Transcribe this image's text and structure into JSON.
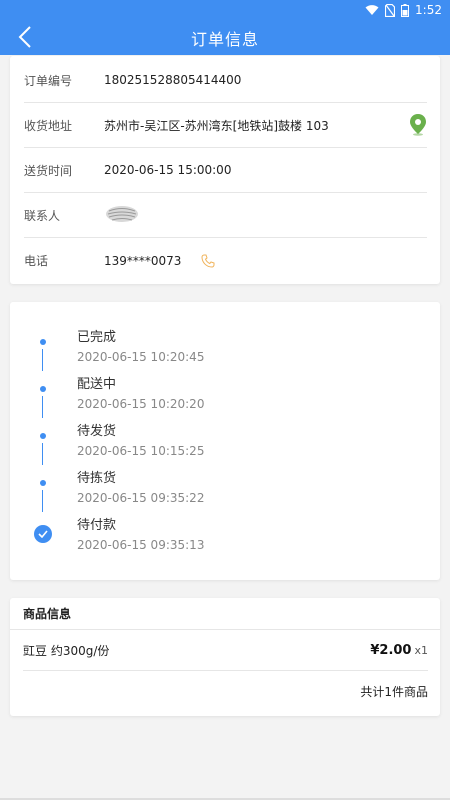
{
  "status_bar": {
    "time": "1:52"
  },
  "header": {
    "title": "订单信息"
  },
  "order": {
    "order_no_label": "订单编号",
    "order_no": "180251528805414400",
    "address_label": "收货地址",
    "address": "苏州市-吴江区-苏州湾东[地铁站]鼓楼 103",
    "delivery_time_label": "送货时间",
    "delivery_time": "2020-06-15 15:00:00",
    "contact_label": "联系人",
    "phone_label": "电话",
    "phone": "139****0073"
  },
  "timeline": [
    {
      "status": "已完成",
      "time": "2020-06-15 10:20:45"
    },
    {
      "status": "配送中",
      "time": "2020-06-15 10:20:20"
    },
    {
      "status": "待发货",
      "time": "2020-06-15 10:15:25"
    },
    {
      "status": "待拣货",
      "time": "2020-06-15 09:35:22"
    },
    {
      "status": "待付款",
      "time": "2020-06-15 09:35:13"
    }
  ],
  "goods": {
    "header": "商品信息",
    "items": [
      {
        "name": "豇豆 约300g/份",
        "price": "¥2.00",
        "qty": "x1"
      }
    ],
    "total": "共计1件商品"
  },
  "colors": {
    "primary": "#3f8ef2",
    "map_pin": "#6ab04c",
    "phone_icon": "#f0b35a"
  },
  "icons": {
    "back": "chevron-left-icon",
    "map": "map-pin-icon",
    "phone": "phone-icon",
    "check": "check-circle-icon"
  }
}
